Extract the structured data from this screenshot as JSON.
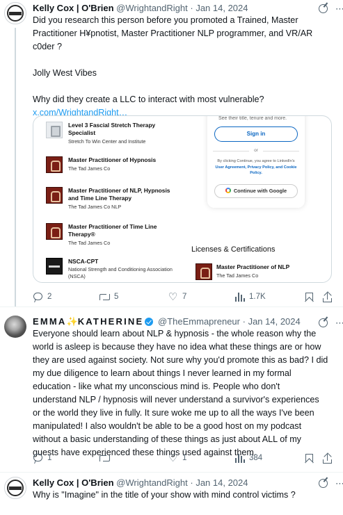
{
  "tweets": [
    {
      "name": "Kelly Cox | O'Brien",
      "handle": "@WrightandRight",
      "date": "Jan 14, 2024",
      "text_lines": [
        "Did you research this person before you promoted a Trained, Master",
        "Practitioner H¥pnotist, Master Practitioner NLP programmer, and VR/AR",
        "c0der ?",
        "",
        "Jolly West Vibes",
        "",
        "Why did they create a LLC to interact with most vulnerable?"
      ],
      "link": "x.com/WrightandRight…",
      "stats": {
        "replies": "2",
        "reposts": "5",
        "likes": "7",
        "views": "1.7K"
      }
    },
    {
      "name_part1": "EMMA",
      "sparkle": "✨",
      "name_part2": "KATHERINE",
      "handle": "@TheEmmapreneur",
      "date": "Jan 14, 2024",
      "text_lines": [
        "Everyone should learn about NLP & hypnosis - the whole reason why the",
        "world is asleep is because they have no idea what these things are or how",
        "they are used against society. Not sure why you'd promote this as bad? I did",
        "my due diligence to learn about things I never learned in my formal",
        "education - like what my unconscious mind is. People who don't",
        "understand NLP / hypnosis will never understand a survivor's experiences",
        "or the world they live in fully. It sure woke me up to all the ways I've been",
        "manipulated! I also wouldn't be able to be a good host on my podcast",
        "without a basic understanding of these things as just about ALL of my",
        "guests have experienced these things used against them."
      ],
      "stats": {
        "replies": "1",
        "reposts": "",
        "likes": "1",
        "views": "384"
      }
    },
    {
      "name": "Kelly Cox | O'Brien",
      "handle": "@WrightandRight",
      "date": "Jan 14, 2024",
      "text_lines": [
        "Why is \"Imagine\" in the title of your show with mind control victims ?"
      ]
    }
  ],
  "card": {
    "licenses": [
      {
        "title": "Level 3 Fascial Stretch Therapy Specialist",
        "org": "Stretch To Win Center and Institute"
      },
      {
        "title": "Master Practitioner of Hypnosis",
        "org": "The Tad James Co"
      },
      {
        "title": "Master Practitioner of NLP, Hypnosis and Time Line Therapy",
        "org": "The Tad James Co NLP"
      },
      {
        "title": "Master Practitioner of Time Line Therapy®",
        "org": "The Tad James Co"
      },
      {
        "title": "NSCA-CPT",
        "org": "National Strength and Conditioning Association (NSCA)"
      }
    ],
    "signin": {
      "top_text": "See their title, tenure and more.",
      "button": "Sign in",
      "or": "or",
      "terms_prefix": "By clicking Continue, you agree to LinkedIn's",
      "terms_links": "User Agreement, Privacy Policy, and Cookie Policy.",
      "google_button": "Continue with Google"
    },
    "section_heading": "Licenses & Certifications",
    "featured": {
      "title": "Master Practitioner of NLP",
      "org": "The Tad James Co"
    }
  }
}
